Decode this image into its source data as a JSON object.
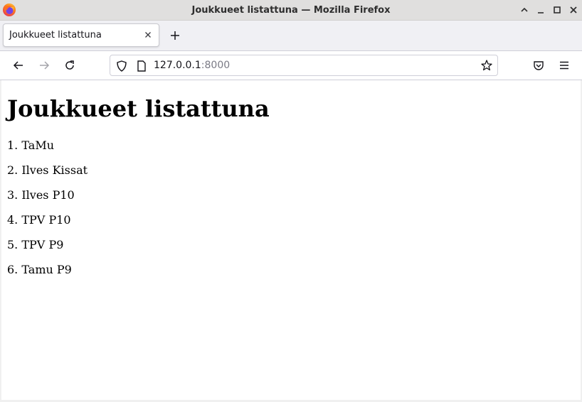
{
  "window": {
    "title": "Joukkueet listattuna — Mozilla Firefox"
  },
  "tabs": [
    {
      "label": "Joukkueet listattuna"
    }
  ],
  "urlbar": {
    "host": "127.0.0.1",
    "port": ":8000"
  },
  "page": {
    "heading": "Joukkueet listattuna",
    "items": [
      {
        "num": "1.",
        "name": "TaMu"
      },
      {
        "num": "2.",
        "name": "Ilves Kissat"
      },
      {
        "num": "3.",
        "name": "Ilves P10"
      },
      {
        "num": "4.",
        "name": "TPV P10"
      },
      {
        "num": "5.",
        "name": "TPV P9"
      },
      {
        "num": "6.",
        "name": "Tamu P9"
      }
    ]
  },
  "icons": {
    "logo": "firefox-logo-icon",
    "minimize": "minimize-icon",
    "maximize": "maximize-icon",
    "close": "close-icon",
    "back": "arrow-left-icon",
    "forward": "arrow-right-icon",
    "reload": "reload-icon",
    "shield": "shield-icon",
    "page": "page-icon",
    "bookmark": "star-icon",
    "pocket": "pocket-icon",
    "menu": "hamburger-menu-icon"
  },
  "colors": {
    "titlebar": "#e0dfde",
    "tabstrip": "#f0f0f4",
    "text": "#15141a",
    "port": "#7a7a85"
  }
}
